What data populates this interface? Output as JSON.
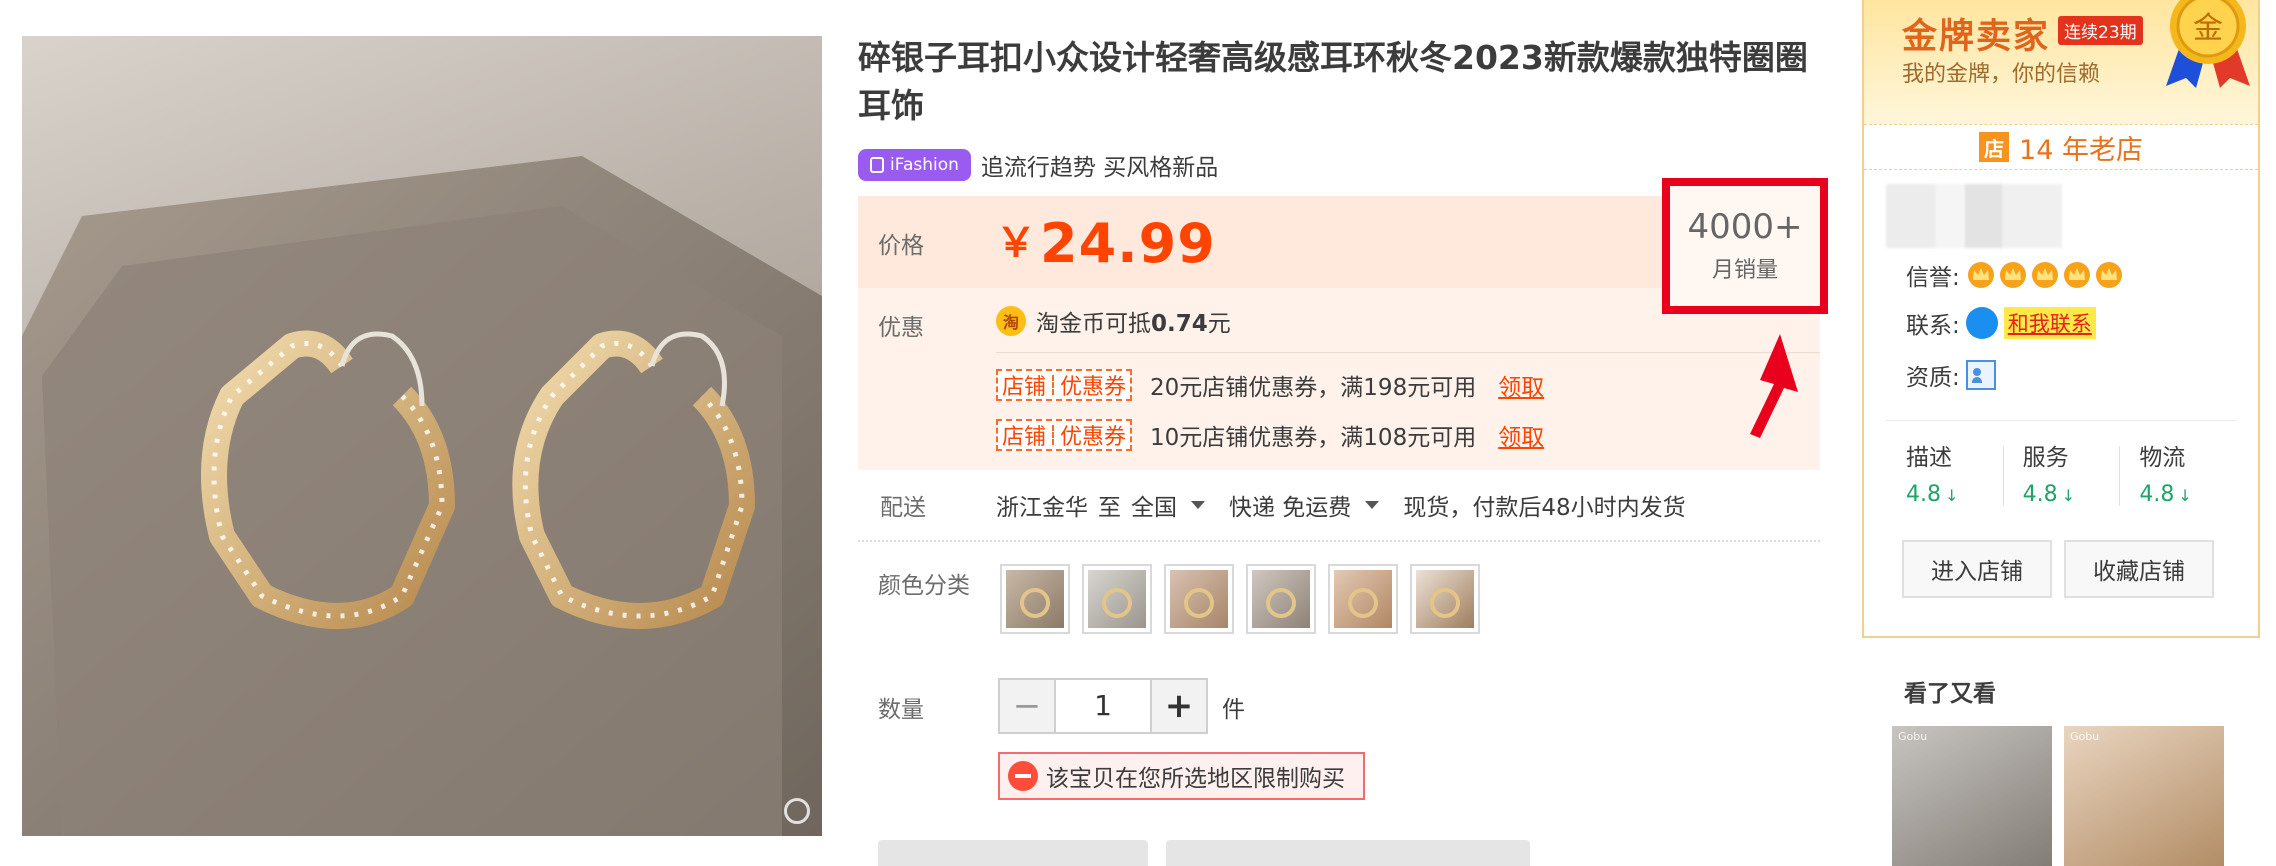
{
  "product": {
    "title": "碎银子耳扣小众设计轻奢高级感耳环秋冬2023新款爆款独特圈圈耳饰",
    "ifashion_badge": "iFashion",
    "ifashion_slogan": "追流行趋势 买风格新品"
  },
  "price": {
    "label": "价格",
    "currency": "￥",
    "value": "24.99",
    "monthly_sales": "4000+",
    "monthly_sales_label": "月销量"
  },
  "discount": {
    "label": "优惠",
    "coin_icon": "淘",
    "coin_text_prefix": "淘金币可抵",
    "coin_amount": "0.74",
    "coin_text_suffix": "元",
    "coupons": [
      {
        "tag_left": "店铺",
        "tag_right": "优惠券",
        "text": "20元店铺优惠券，满198元可用",
        "claim": "领取"
      },
      {
        "tag_left": "店铺",
        "tag_right": "优惠券",
        "text": "10元店铺优惠券，满108元可用",
        "claim": "领取"
      }
    ]
  },
  "shipping": {
    "label": "配送",
    "origin": "浙江金华",
    "to": "至",
    "destination": "全国",
    "method": "快递 免运费",
    "note": "现货，付款后48小时内发货"
  },
  "color": {
    "label": "颜色分类",
    "swatch_count": 6
  },
  "quantity": {
    "label": "数量",
    "minus": "−",
    "value": "1",
    "plus": "+",
    "unit": "件",
    "restriction": "该宝贝在您所选地区限制购买"
  },
  "shop": {
    "gold_title": "金牌卖家",
    "gold_streak": "连续23期",
    "gold_sub": "我的金牌，你的信赖",
    "medal_char": "金",
    "shop_icon": "店",
    "years": "14 年老店",
    "reputation_label": "信誉:",
    "crown_count": 5,
    "contact_label": "联系:",
    "contact_link": "和我联系",
    "qualification_label": "资质:",
    "scores": [
      {
        "label": "描述",
        "value": "4.8",
        "trend": "↓"
      },
      {
        "label": "服务",
        "value": "4.8",
        "trend": "↓"
      },
      {
        "label": "物流",
        "value": "4.8",
        "trend": "↓"
      }
    ],
    "enter_button": "进入店铺",
    "favorite_button": "收藏店铺",
    "also_viewed_title": "看了又看",
    "thumb_mark": "Gobu"
  },
  "colors": {
    "price_orange": "#ff4400",
    "highlight_red": "#e8001d",
    "ifashion_purple": "#9a5cf0",
    "rating_green": "#1ea46a"
  }
}
